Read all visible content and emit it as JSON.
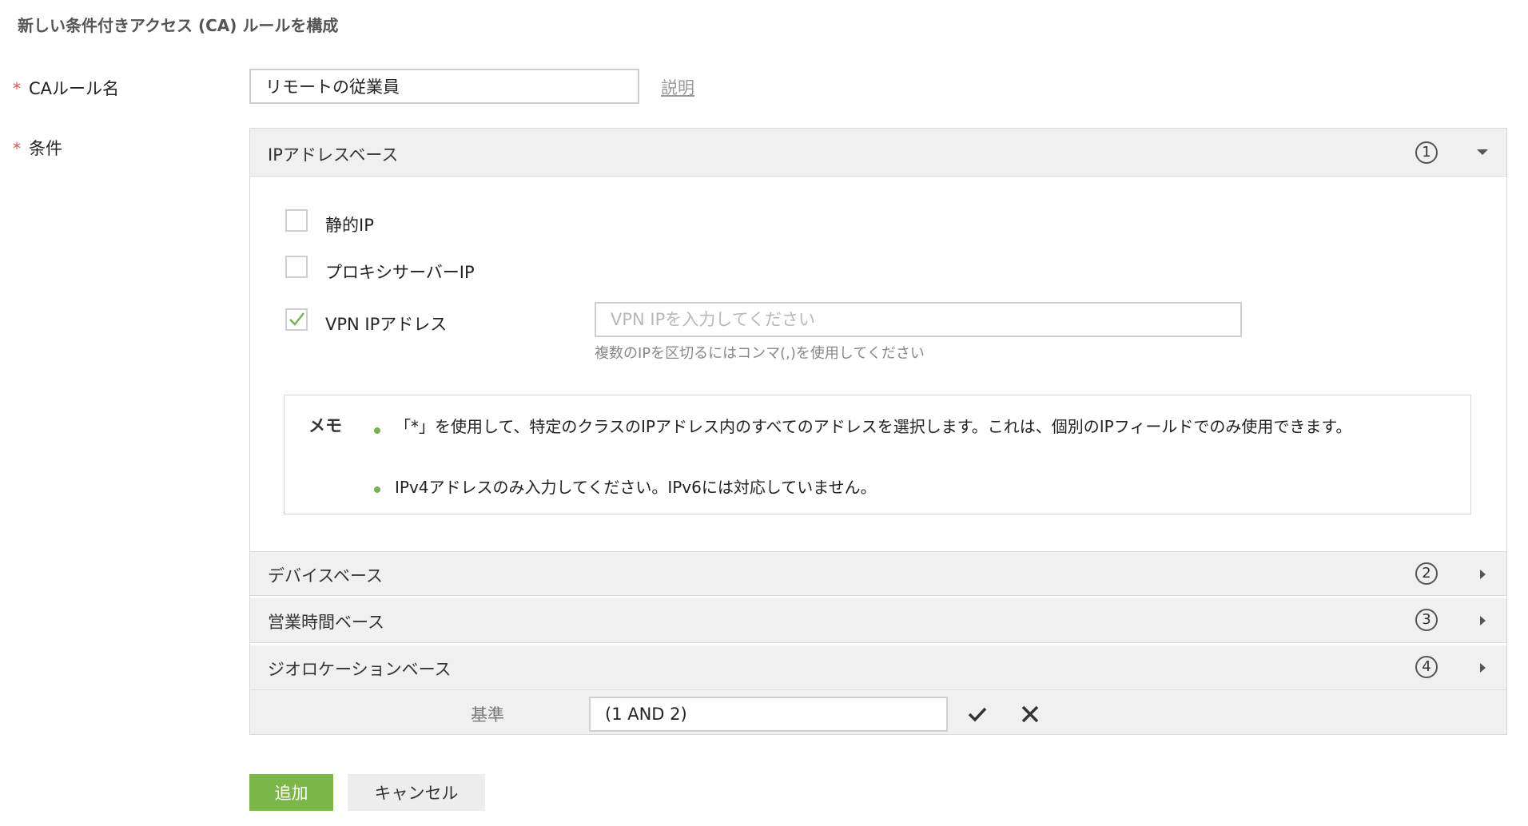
{
  "page": {
    "title": "新しい条件付きアクセス (CA) ルールを構成"
  },
  "rule_name": {
    "required_mark": "*",
    "label": "CAルール名",
    "value": "リモートの従業員",
    "description_link": "説明"
  },
  "conditions": {
    "required_mark": "*",
    "label": "条件",
    "sections": [
      {
        "title": "IPアドレスベース",
        "number": "1",
        "expanded": true
      },
      {
        "title": "デバイスベース",
        "number": "2",
        "expanded": false
      },
      {
        "title": "営業時間ベース",
        "number": "3",
        "expanded": false
      },
      {
        "title": "ジオロケーションベース",
        "number": "4",
        "expanded": false
      }
    ],
    "ip_options": [
      {
        "label": "静的IP",
        "checked": false
      },
      {
        "label": "プロキシサーバーIP",
        "checked": false
      },
      {
        "label": "VPN IPアドレス",
        "checked": true
      }
    ],
    "vpn_input": {
      "placeholder": "VPN IPを入力してください",
      "hint": "複数のIPを区切るにはコンマ(,)を使用してください"
    },
    "memo": {
      "title": "メモ",
      "items": [
        "「*」を使用して、特定のクラスのIPアドレス内のすべてのアドレスを選択します。これは、個別のIPフィールドでのみ使用できます。",
        "IPv4アドレスのみ入力してください。IPv6には対応していません。"
      ]
    },
    "criteria": {
      "label": "基準",
      "value": "(1 AND 2)"
    }
  },
  "buttons": {
    "add": "追加",
    "cancel": "キャンセル"
  },
  "colors": {
    "accent_green": "#7ab648",
    "bullet_green": "#77b255",
    "required_red": "#d9534f"
  }
}
